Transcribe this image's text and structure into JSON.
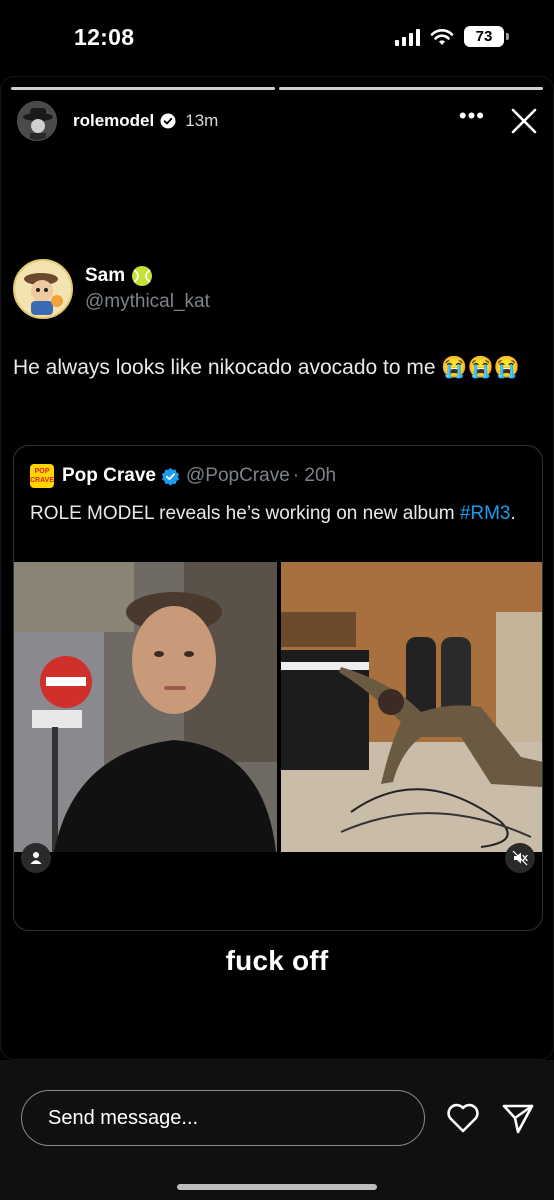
{
  "status_bar": {
    "time": "12:08",
    "battery": "73"
  },
  "story": {
    "username": "rolemodel",
    "time_ago": "13m",
    "progress_segments": [
      1,
      1
    ]
  },
  "tweet": {
    "author_name": "Sam",
    "author_handle": "@mythical_kat",
    "text": "He always looks like nikocado avocado to me 😭😭😭",
    "quoted": {
      "name": "Pop Crave",
      "handle": "@PopCrave",
      "time": "· 20h",
      "logo_text": "POP CRAVE",
      "text": "ROLE MODEL reveals he’s working on new album ",
      "hashtag": "#RM3",
      "trailing": "."
    }
  },
  "overlay_text": "fuck off",
  "bottom_bar": {
    "message_placeholder": "Send message..."
  },
  "colors": {
    "background": "#000000",
    "handle_gray": "#7e838a",
    "link_blue": "#1d9bf0",
    "verified_blue": "#1d9bf0"
  }
}
